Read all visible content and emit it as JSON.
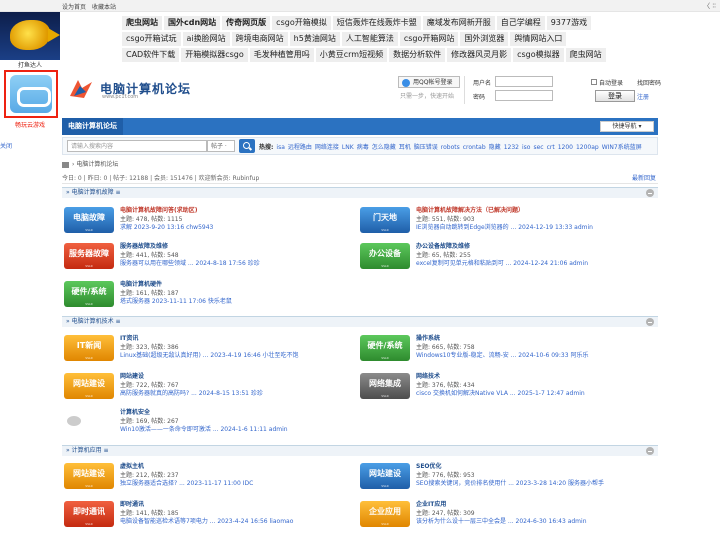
{
  "topbar": {
    "set_home": "设为首页",
    "favorite": "收藏本站",
    "close": "〈 ∶∶"
  },
  "sidead": {
    "ad1_label": "打鱼达人",
    "ad2_label": "畅玩云游戏",
    "close": "关闭"
  },
  "links": [
    [
      "爬虫网站",
      "国外cdn网站",
      "传奇网页版",
      "csgo开箱模拟",
      "短信轰炸在线轰炸卡盟",
      "魔域发布网新开服",
      "自己学编程",
      "9377游戏"
    ],
    [
      "csgo开箱试玩",
      "ai换脸网站",
      "跨境电商网站",
      "h5黄油网站",
      "人工智能算法",
      "csgo开箱网站",
      "国外浏览器",
      "舆情网站入口"
    ],
    [
      "CAD软件下载",
      "开箱模拟器csgo",
      "毛发种植管用吗",
      "小黄豆crm短视频",
      "数据分析软件",
      "修改器风灵月影",
      "csgo模拟器",
      "爬虫网站"
    ]
  ],
  "links_bold": [
    "爬虫网站",
    "国外cdn网站",
    "传奇网页版"
  ],
  "logo": {
    "title": "电脑计算机论坛",
    "url": "www.pc1f.com"
  },
  "qq": {
    "button": "用QQ帐号登录",
    "sub": "只需一步，快速开始"
  },
  "login": {
    "user_label": "用户名",
    "pass_label": "密码",
    "auto": "自动登录",
    "forgot": "找回密码",
    "submit": "登录",
    "register": "注册"
  },
  "nav": {
    "home": "电脑计算机论坛",
    "quick": "快捷导航 ▾"
  },
  "search": {
    "placeholder": "请输入搜索内容",
    "type": "帖子 ·",
    "hot_label": "热搜:",
    "hot": [
      "isa",
      "远程路由",
      "网络连接",
      "LNK",
      "病毒",
      "怎么隐藏",
      "耳机",
      "脑压错误",
      "robots",
      "crontab",
      "隐藏",
      "1232",
      "iso",
      "sec",
      "crt",
      "1200",
      "1200ap",
      "WIN7系统蓝屏"
    ]
  },
  "breadcrumb": "电脑计算机论坛",
  "stats": {
    "text": "今日: 0 | 昨日: 0 | 帖子: 12188 | 会员: 151476 | 欢迎新会员: Rubinfup",
    "latest": "最新回复"
  },
  "sections": [
    {
      "title": "电脑计算机故障 ≡"
    },
    {
      "title": "电脑计算机技术 ≡"
    },
    {
      "title": "计算机应用 ≡"
    }
  ],
  "forums": [
    {
      "icon": "电脑故障",
      "color": "blue",
      "title": "电脑计算机故障问答(求助区)",
      "stats": "主题: 478, 帖数: 1115",
      "last": "求解 2023-9-20 13:16 chw5943",
      "red": true
    },
    {
      "icon": "门天地",
      "color": "blue",
      "title": "电脑计算机故障解决方法（已解决问题）",
      "stats": "主题: 551, 帖数: 903",
      "last": "IE浏览器自动跳转到Edge浏览器的 ... 2024-12-19 13:33 admin",
      "red": true
    },
    {
      "icon": "服务器故障",
      "color": "red",
      "title": "服务器故障及维修",
      "stats": "主题: 441, 帖数: 548",
      "last": "服务器可以用在哪些领域 ... 2024-8-18 17:56 珍珍"
    },
    {
      "icon": "办公设备",
      "color": "green",
      "title": "办公设备故障及维修",
      "stats": "主题: 65, 帖数: 255",
      "last": "excel复制可见单元格和粘贴到可 ... 2024-12-24 21:06 admin"
    },
    {
      "icon": "硬件/系统",
      "color": "green",
      "title": "电脑计算机硬件",
      "stats": "主题: 161, 帖数: 187",
      "last": "塔式服务器 2023-11-11 17:06 快乐老鼠"
    },
    {
      "icon": "IT新闻",
      "color": "orange",
      "title": "IT资讯",
      "stats": "主题: 323, 帖数: 386",
      "last": "Linux基础(超级无敌认真好用) ... 2023-4-19 16:46 小壮至吃不饱"
    },
    {
      "icon": "硬件/系统",
      "color": "green",
      "title": "操作系统",
      "stats": "主题: 665, 帖数: 758",
      "last": "Windows10专业版-稳定、流畅-安 ... 2024-10-6 09:33 阿乐乐"
    },
    {
      "icon": "网站建设",
      "color": "orange",
      "title": "网站建设",
      "stats": "主题: 722, 帖数: 767",
      "last": "高防服务器就真的高防吗? ... 2024-8-15 13:51 珍珍"
    },
    {
      "icon": "网络集成",
      "color": "gray",
      "title": "网络技术",
      "stats": "主题: 376, 帖数: 434",
      "last": "cisco 交换机如何解决Native VLA ... 2025-1-7 12:47 admin"
    },
    {
      "icon": "",
      "color": "plain",
      "title": "计算机安全",
      "stats": "主题: 169, 帖数: 267",
      "last": "Win10激活——一条命令即可激活 ... 2024-1-6 11:11 admin"
    },
    {
      "icon": "网站建设",
      "color": "orange",
      "title": "虚拟主机",
      "stats": "主题: 212, 帖数: 237",
      "last": "独立服务器适合选择? ... 2023-11-17 11:00 IDC"
    },
    {
      "icon": "网站建设",
      "color": "blue",
      "title": "SEO优化",
      "stats": "主题: 776, 帖数: 953",
      "last": "SEO搜索关键词，竞价排名使用什 ... 2023-3-28 14:20 服务器小帮手"
    },
    {
      "icon": "即时通讯",
      "color": "red",
      "title": "即时通讯",
      "stats": "主题: 141, 帖数: 185",
      "last": "电脑设备智能巡检术语等7项电力 ... 2023-4-24 16:56 liaomao"
    },
    {
      "icon": "企业应用",
      "color": "orange",
      "title": "企业IT应用",
      "stats": "主题: 247, 帖数: 309",
      "last": "该分析为什么设十一层三中全会是 ... 2024-6-30 16:43 admin"
    }
  ]
}
